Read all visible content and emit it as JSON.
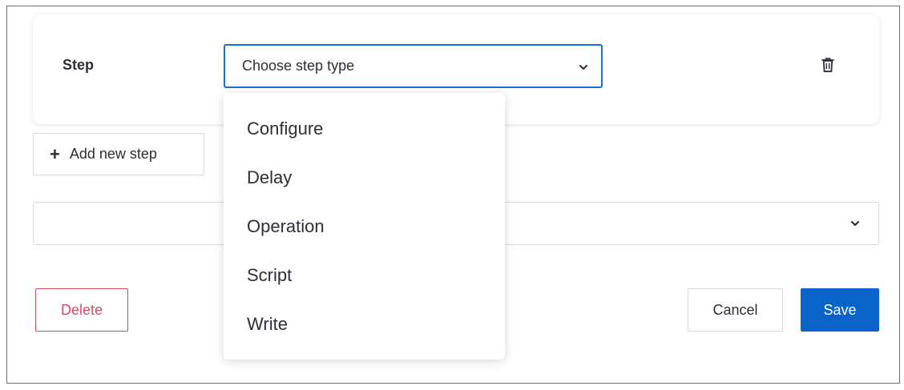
{
  "step": {
    "label": "Step",
    "select_placeholder": "Choose step type",
    "options": [
      "Configure",
      "Delay",
      "Operation",
      "Script",
      "Write"
    ]
  },
  "add_step": {
    "label": "Add new step"
  },
  "secondary_select": {
    "value": ""
  },
  "actions": {
    "delete_label": "Delete",
    "cancel_label": "Cancel",
    "save_label": "Save"
  },
  "colors": {
    "accent": "#0a63c9",
    "focus_border": "#1f6fd1",
    "danger": "#d6485f"
  },
  "icons": {
    "step_select": "chevron-down-icon",
    "remove_step": "trash-icon",
    "add": "plus-icon"
  }
}
